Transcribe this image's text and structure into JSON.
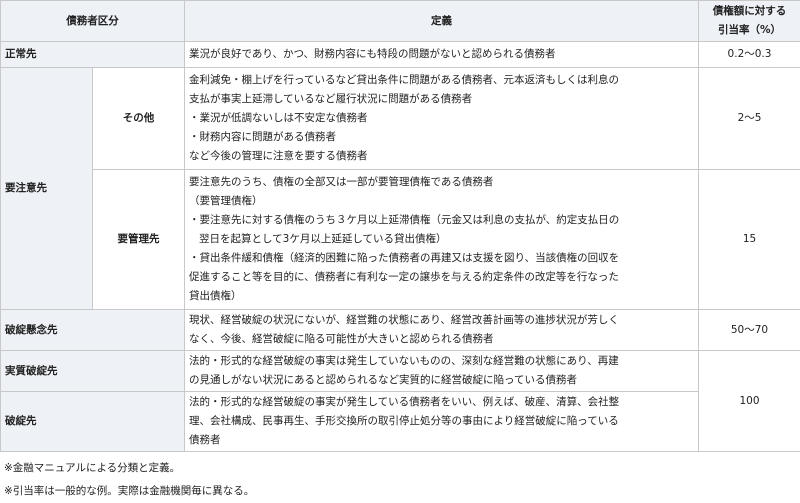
{
  "header": {
    "category": "債務者区分",
    "definition": "定義",
    "rate_line1": "債権額に対する",
    "rate_line2": "引当率（%）"
  },
  "rows": {
    "normal": {
      "category": "正常先",
      "definition": "業況が良好であり、かつ、財務内容にも特段の問題がないと認められる債務者",
      "rate": "0.2〜0.3"
    },
    "caution": {
      "category": "要注意先",
      "other": {
        "subcategory": "その他",
        "def_lines": [
          "金利減免・棚上げを行っているなど貸出条件に問題がある債務者、元本返済もしくは利息の",
          "支払が事実上延滞しているなど履行状況に問題がある債務者",
          "・業況が低調ないしは不安定な債務者",
          "・財務内容に問題がある債務者",
          "など今後の管理に注意を要する債務者"
        ],
        "rate": "2〜5"
      },
      "managed": {
        "subcategory": "要管理先",
        "def_lines": [
          "要注意先のうち、債権の全部又は一部が要管理債権である債務者",
          "（要管理債権）",
          "・要注意先に対する債権のうち３ケ月以上延滞債権（元金又は利息の支払が、約定支払日の",
          "翌日を起算として3ケ月以上延延している貸出債権）",
          "・貸出条件緩和債権（経済的困難に陥った債務者の再建又は支援を図り、当該債権の回収を",
          "促進すること等を目的に、債務者に有利な一定の譲歩を与える約定条件の改定等を行なった",
          "貸出債権）"
        ],
        "rate": "15"
      }
    },
    "doubtful": {
      "category": "破綻懸念先",
      "def_lines": [
        "現状、経営破綻の状況にないが、経営難の状態にあり、経営改善計画等の進捗状況が芳しく",
        "なく、今後、経営破綻に陥る可能性が大きいと認められる債務者"
      ],
      "rate": "50〜70"
    },
    "effectively_bankrupt": {
      "category": "実質破綻先",
      "def_lines": [
        "法的・形式的な経営破綻の事実は発生していないものの、深刻な経営難の状態にあり、再建",
        "の見通しがない状況にあると認められるなど実質的に経営破綻に陥っている債務者"
      ],
      "rate": "100"
    },
    "bankrupt": {
      "category": "破綻先",
      "def_lines": [
        "法的・形式的な経営破綻の事実が発生している債務者をいい、例えば、破産、清算、会社整",
        "理、会社構成、民事再生、手形交換所の取引停止処分等の事由により経営破綻に陥っている",
        "債務者"
      ]
    }
  },
  "notes": [
    "※金融マニュアルによる分類と定義。",
    "※引当率は一般的な例。実際は金融機関毎に異なる。"
  ]
}
